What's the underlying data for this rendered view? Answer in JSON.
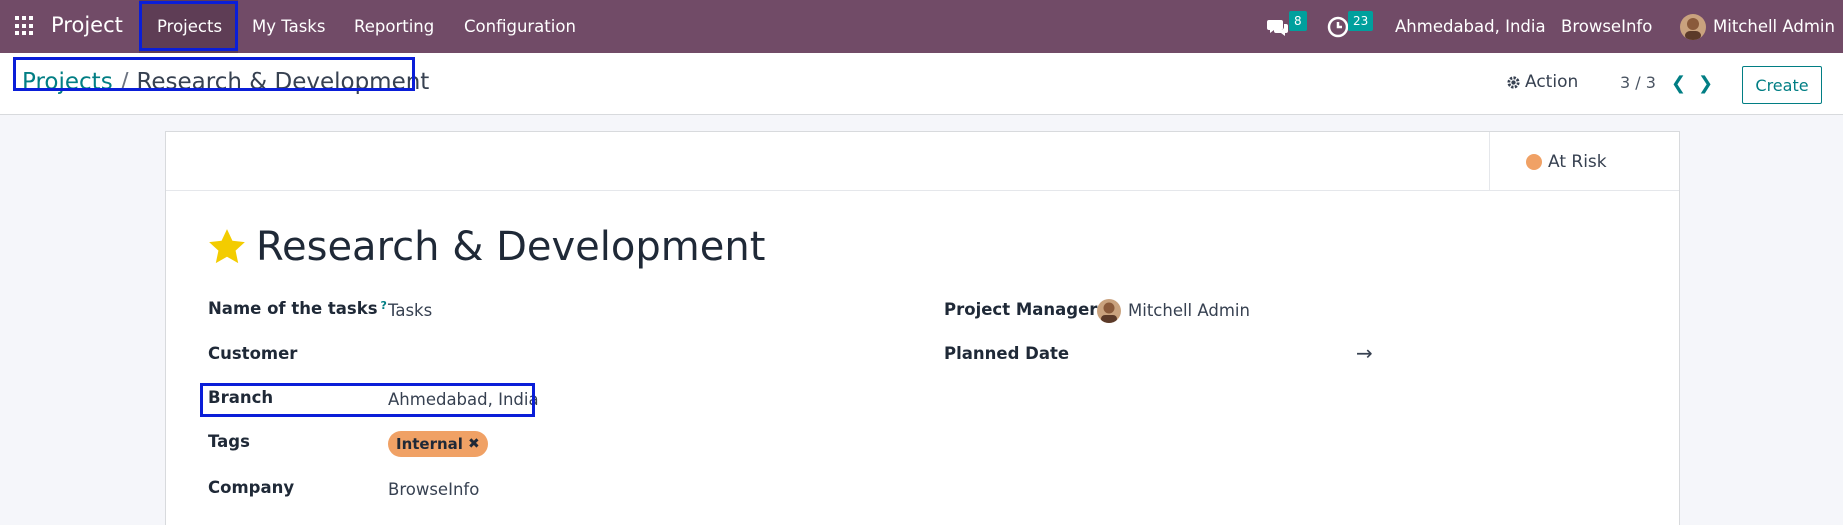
{
  "topbar": {
    "app_name": "Project",
    "menu": [
      "Projects",
      "My Tasks",
      "Reporting",
      "Configuration"
    ],
    "messages_count": "8",
    "activities_count": "23",
    "branch": "Ahmedabad, India",
    "company": "BrowseInfo",
    "user": "Mitchell Admin"
  },
  "controlbar": {
    "breadcrumb_parent": "Projects",
    "breadcrumb_current": "Research & Development",
    "action_label": "Action",
    "pager": "3 / 3",
    "create_label": "Create"
  },
  "form": {
    "status": "At Risk",
    "title": "Research & Development",
    "fields": {
      "name_of_tasks_label": "Name of the tasks",
      "name_of_tasks_help": "?",
      "name_of_tasks_value": "Tasks",
      "customer_label": "Customer",
      "branch_label": "Branch",
      "branch_value": "Ahmedabad, India",
      "tags_label": "Tags",
      "tag_internal": "Internal",
      "company_label": "Company",
      "company_value": "BrowseInfo",
      "project_manager_label": "Project Manager",
      "project_manager_value": "Mitchell Admin",
      "planned_date_label": "Planned Date",
      "planned_date_arrow": "→"
    }
  },
  "colors": {
    "navbar": "#714b67",
    "accent": "#017e84",
    "highlight": "#0a1ed8",
    "status_at_risk": "#f0a165",
    "star": "#f3cc00"
  }
}
